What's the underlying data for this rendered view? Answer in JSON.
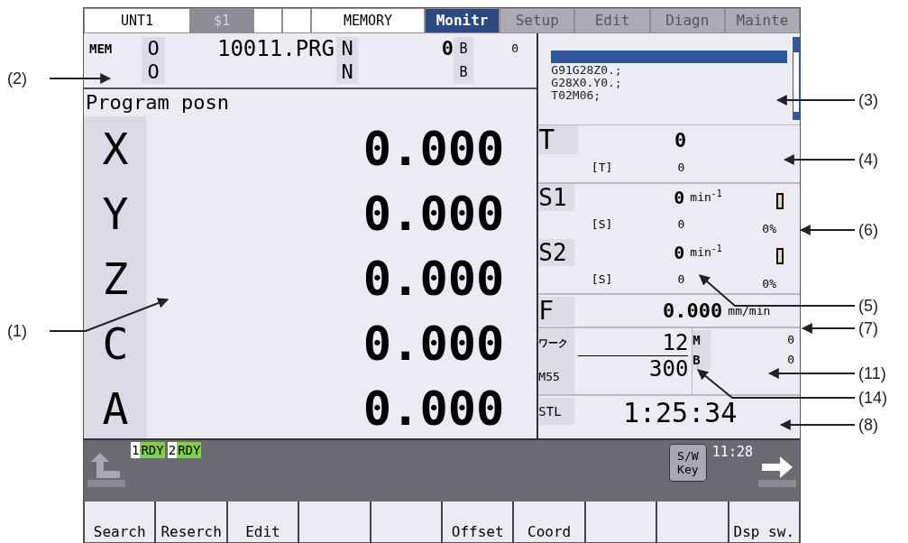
{
  "status": {
    "unit": "UNT1",
    "system": "$1",
    "mode": "MEMORY"
  },
  "tabs": [
    {
      "label": "Monitr",
      "selected": true
    },
    {
      "label": "Setup",
      "selected": false
    },
    {
      "label": "Edit",
      "selected": false
    },
    {
      "label": "Diagn",
      "selected": false
    },
    {
      "label": "Mainte",
      "selected": false
    }
  ],
  "program_header": {
    "mode": "MEM",
    "rows": [
      {
        "o_label": "O",
        "program": "10011.PRG",
        "n_label": "N",
        "n_value": "0",
        "b_label": "B",
        "b_value": "0"
      },
      {
        "o_label": "O",
        "n_label": "N",
        "b_label": "B"
      }
    ]
  },
  "position": {
    "title": "Program posn",
    "axes": [
      {
        "name": "X",
        "value": "0.000"
      },
      {
        "name": "Y",
        "value": "0.000"
      },
      {
        "name": "Z",
        "value": "0.000"
      },
      {
        "name": "C",
        "value": "0.000"
      },
      {
        "name": "A",
        "value": "0.000"
      }
    ]
  },
  "program_buffer": {
    "lines": [
      "G91G28Z0.;",
      "G28X0.Y0.;",
      "T02M06;"
    ]
  },
  "tool": {
    "label": "T",
    "value": "0",
    "command_label": "[T]",
    "command_value": "0"
  },
  "spindles": [
    {
      "label": "S1",
      "value": "0",
      "unit": "min$^{-1}$",
      "command_label": "[S]",
      "command_value": "0",
      "load": "0%",
      "level": 0
    },
    {
      "label": "S2",
      "value": "0",
      "unit": "min$^{-1}$",
      "command_label": "[S]",
      "command_value": "0",
      "load": "0%",
      "level": 0
    }
  ],
  "feed": {
    "label": "F",
    "value": "0.000",
    "unit": "mm/min"
  },
  "work_counter": {
    "label": "ワーク",
    "count": "12",
    "code": "M55",
    "target": "300"
  },
  "mb": [
    {
      "label": "M",
      "value": "0"
    },
    {
      "label": "B",
      "value": "0"
    }
  ],
  "time": {
    "label": "STL",
    "value": "1:25:34"
  },
  "status_bar": {
    "ready": [
      {
        "number": "1",
        "text": "RDY"
      },
      {
        "number": "2",
        "text": "RDY"
      }
    ],
    "key_lines": [
      "S/W",
      "Key"
    ],
    "clock": "11:28"
  },
  "softkeys": [
    {
      "kind": "label",
      "label": "Search"
    },
    {
      "kind": "label",
      "label": "Reserch"
    },
    {
      "kind": "label",
      "label": "Edit"
    },
    {
      "kind": "blank"
    },
    {
      "kind": "blank"
    },
    {
      "kind": "label",
      "label": "Offset"
    },
    {
      "kind": "label",
      "label": "Coord"
    },
    {
      "kind": "blank"
    },
    {
      "kind": "blank"
    },
    {
      "kind": "label",
      "label": "Dsp sw."
    }
  ],
  "callouts": [
    {
      "label": "(2)"
    },
    {
      "label": "(1)"
    },
    {
      "label": "(3)"
    },
    {
      "label": "(4)"
    },
    {
      "label": "(6)"
    },
    {
      "label": "(5)"
    },
    {
      "label": "(7)"
    },
    {
      "label": "(11)"
    },
    {
      "label": "(14)"
    },
    {
      "label": "(8)"
    }
  ]
}
